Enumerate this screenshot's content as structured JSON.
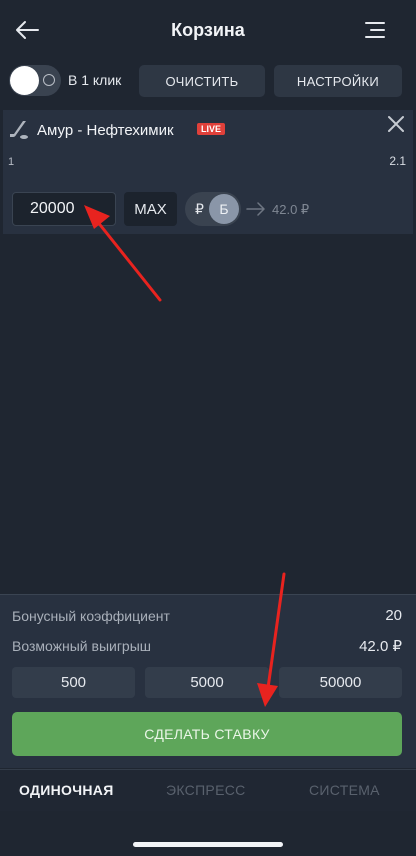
{
  "header": {
    "title": "Корзина"
  },
  "toolbar": {
    "one_click_label": "В 1 клик",
    "one_click_enabled": false,
    "clear_label": "ОЧИСТИТЬ",
    "settings_label": "НАСТРОЙКИ"
  },
  "bet": {
    "match": "Амур - Нефтехимик",
    "live_badge": "LIVE",
    "outcome": "1",
    "odds": "2.1",
    "stake": "20000",
    "max_label": "MAX",
    "currency_rub": "₽",
    "currency_bonus": "Б",
    "payout": "42.0 ₽"
  },
  "summary": {
    "bonus_coef_label": "Бонусный коэффициент",
    "bonus_coef_value": "20",
    "possible_win_label": "Возможный выигрыш",
    "possible_win_value": "42.0 ₽",
    "quick_amounts": [
      "500",
      "5000",
      "50000"
    ],
    "submit_label": "СДЕЛАТЬ СТАВКУ"
  },
  "tabs": {
    "single": "ОДИНОЧНАЯ",
    "express": "ЭКСПРЕСС",
    "system": "СИСТЕМА",
    "active": "single"
  },
  "colors": {
    "background": "#1f2631",
    "card": "#283140",
    "accent_green": "#5ea65a",
    "live_red": "#e0403a",
    "annotation_red": "#e8231f"
  }
}
